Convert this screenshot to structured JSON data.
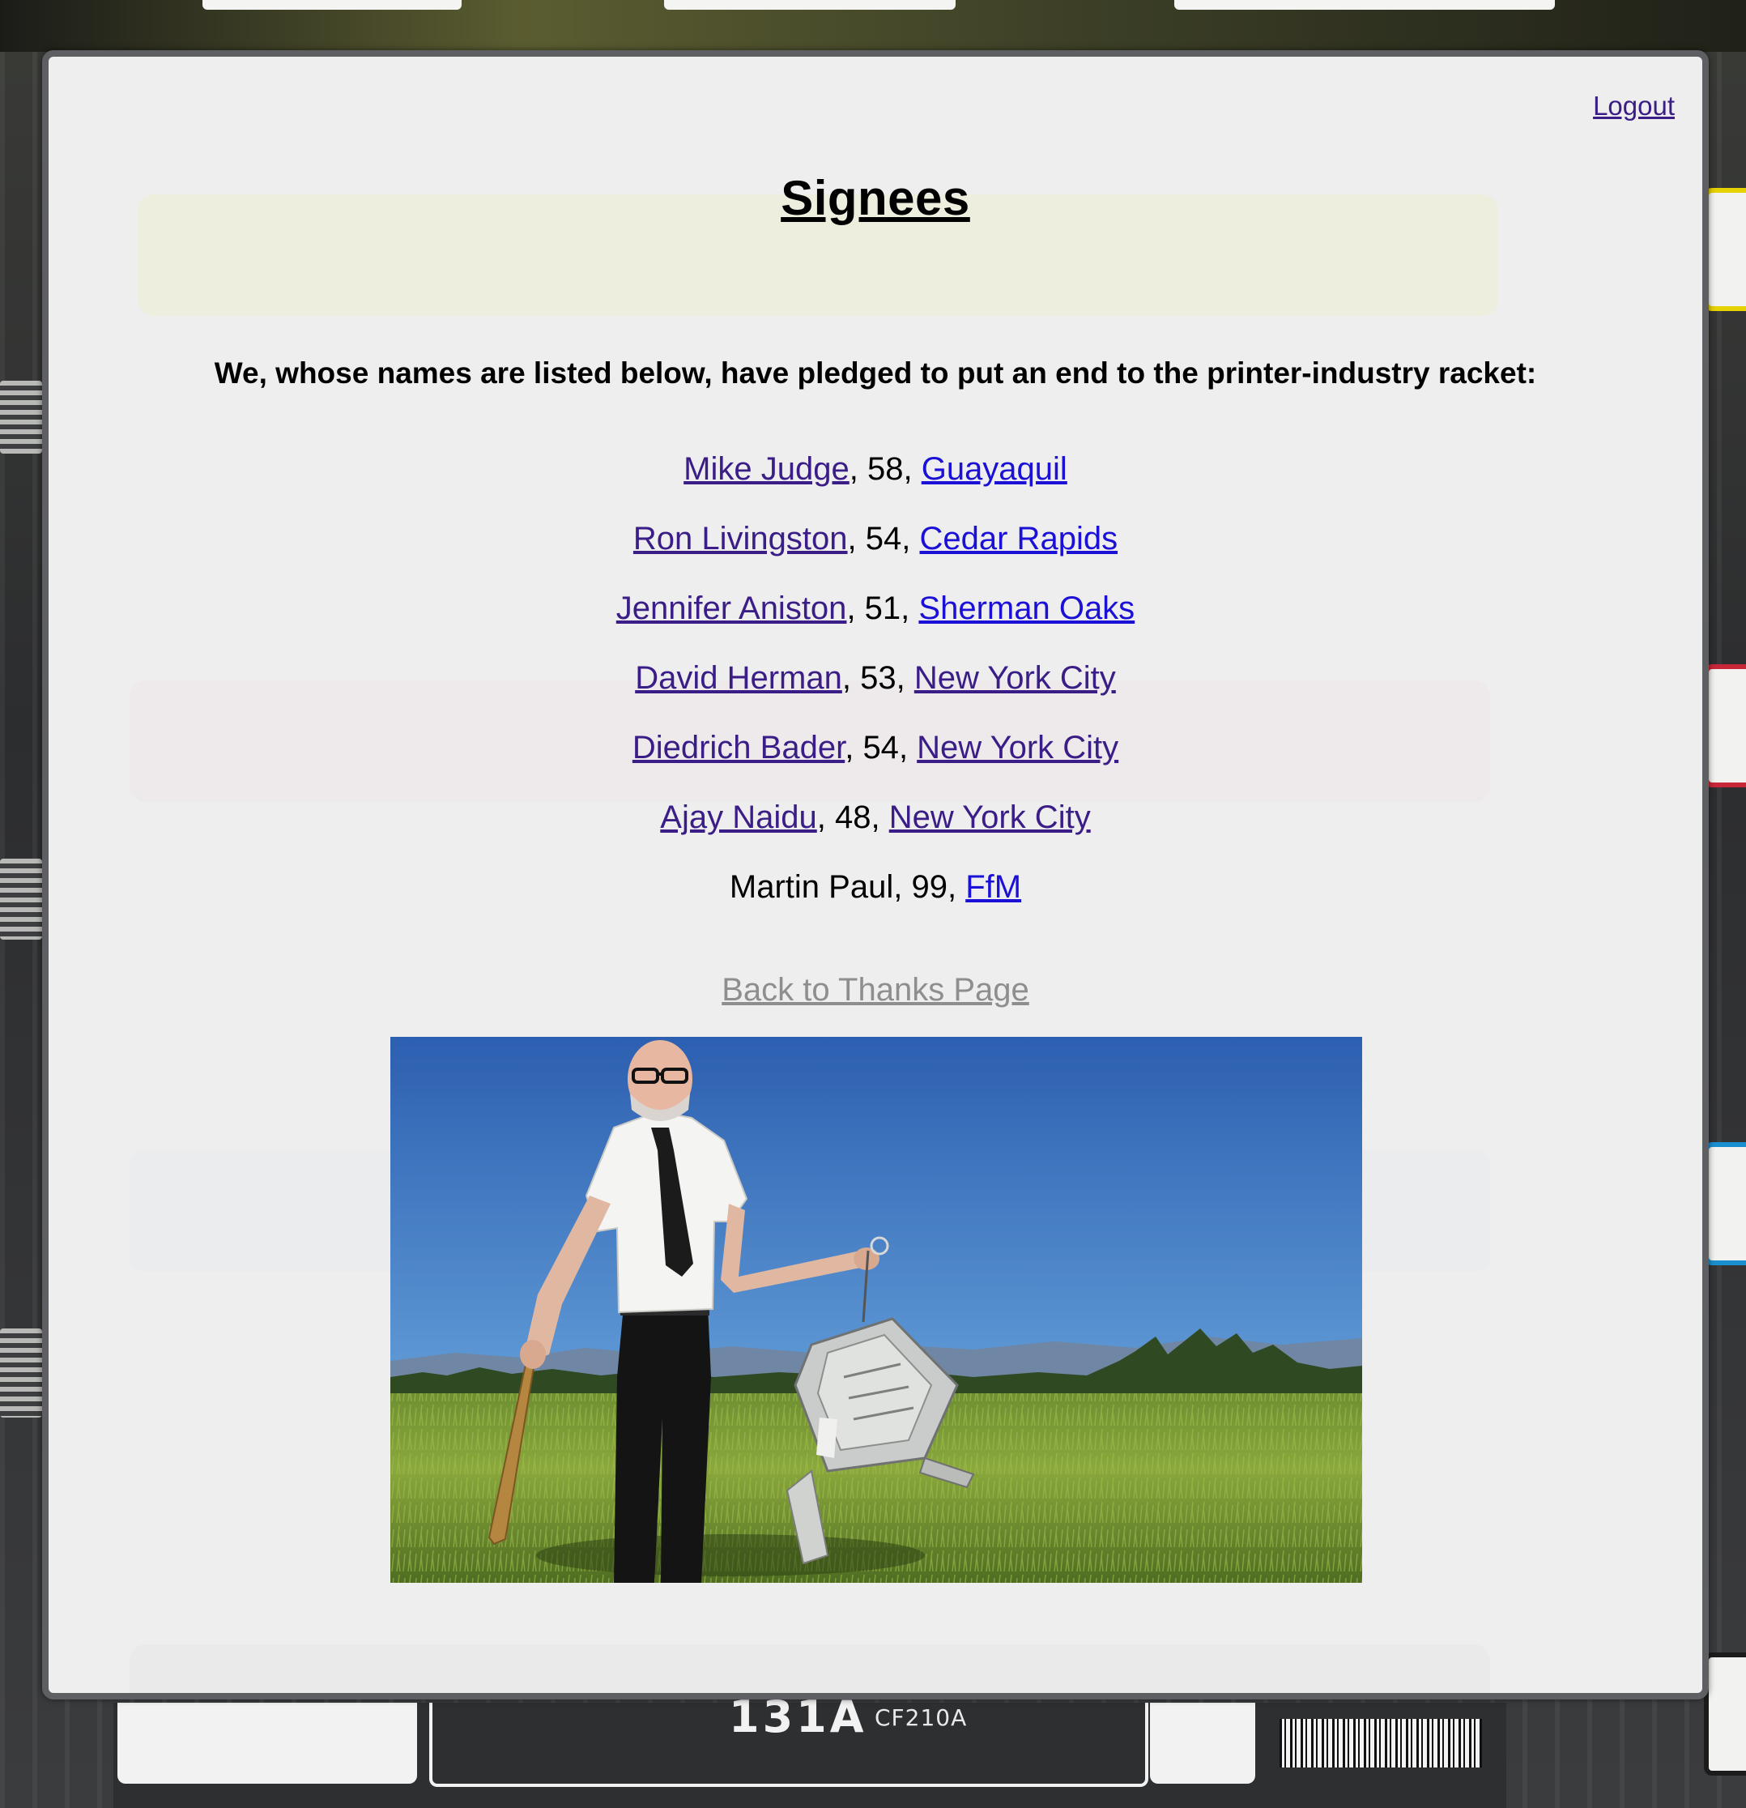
{
  "header": {
    "logout_label": "Logout"
  },
  "page": {
    "title": "Signees",
    "intro": "We, whose names are listed below, have pledged to put an end to the printer-industry racket:",
    "back_link_label": "Back to Thanks Page"
  },
  "signees": [
    {
      "name": "Mike Judge",
      "age": "58",
      "city": "Guayaquil",
      "name_is_link": true,
      "city_visited": false
    },
    {
      "name": "Ron Livingston",
      "age": "54",
      "city": "Cedar Rapids",
      "name_is_link": true,
      "city_visited": false
    },
    {
      "name": "Jennifer Aniston",
      "age": "51",
      "city": "Sherman Oaks",
      "name_is_link": true,
      "city_visited": false
    },
    {
      "name": "David Herman",
      "age": "53",
      "city": "New York City",
      "name_is_link": true,
      "city_visited": true
    },
    {
      "name": "Diedrich Bader",
      "age": "54",
      "city": "New York City",
      "name_is_link": true,
      "city_visited": true
    },
    {
      "name": "Ajay Naidu",
      "age": "48",
      "city": "New York City",
      "name_is_link": true,
      "city_visited": true
    },
    {
      "name": "Martin Paul",
      "age": "99",
      "city": "FfM",
      "name_is_link": false,
      "city_visited": false
    }
  ],
  "background": {
    "cartridge_text": "131A",
    "cartridge_code": "CF210A"
  },
  "colors": {
    "visited_link": "#3a1d86",
    "unvisited_link": "#1a10d6",
    "muted_link": "#8e8e8e",
    "panel_bg": "#eeeeee"
  }
}
